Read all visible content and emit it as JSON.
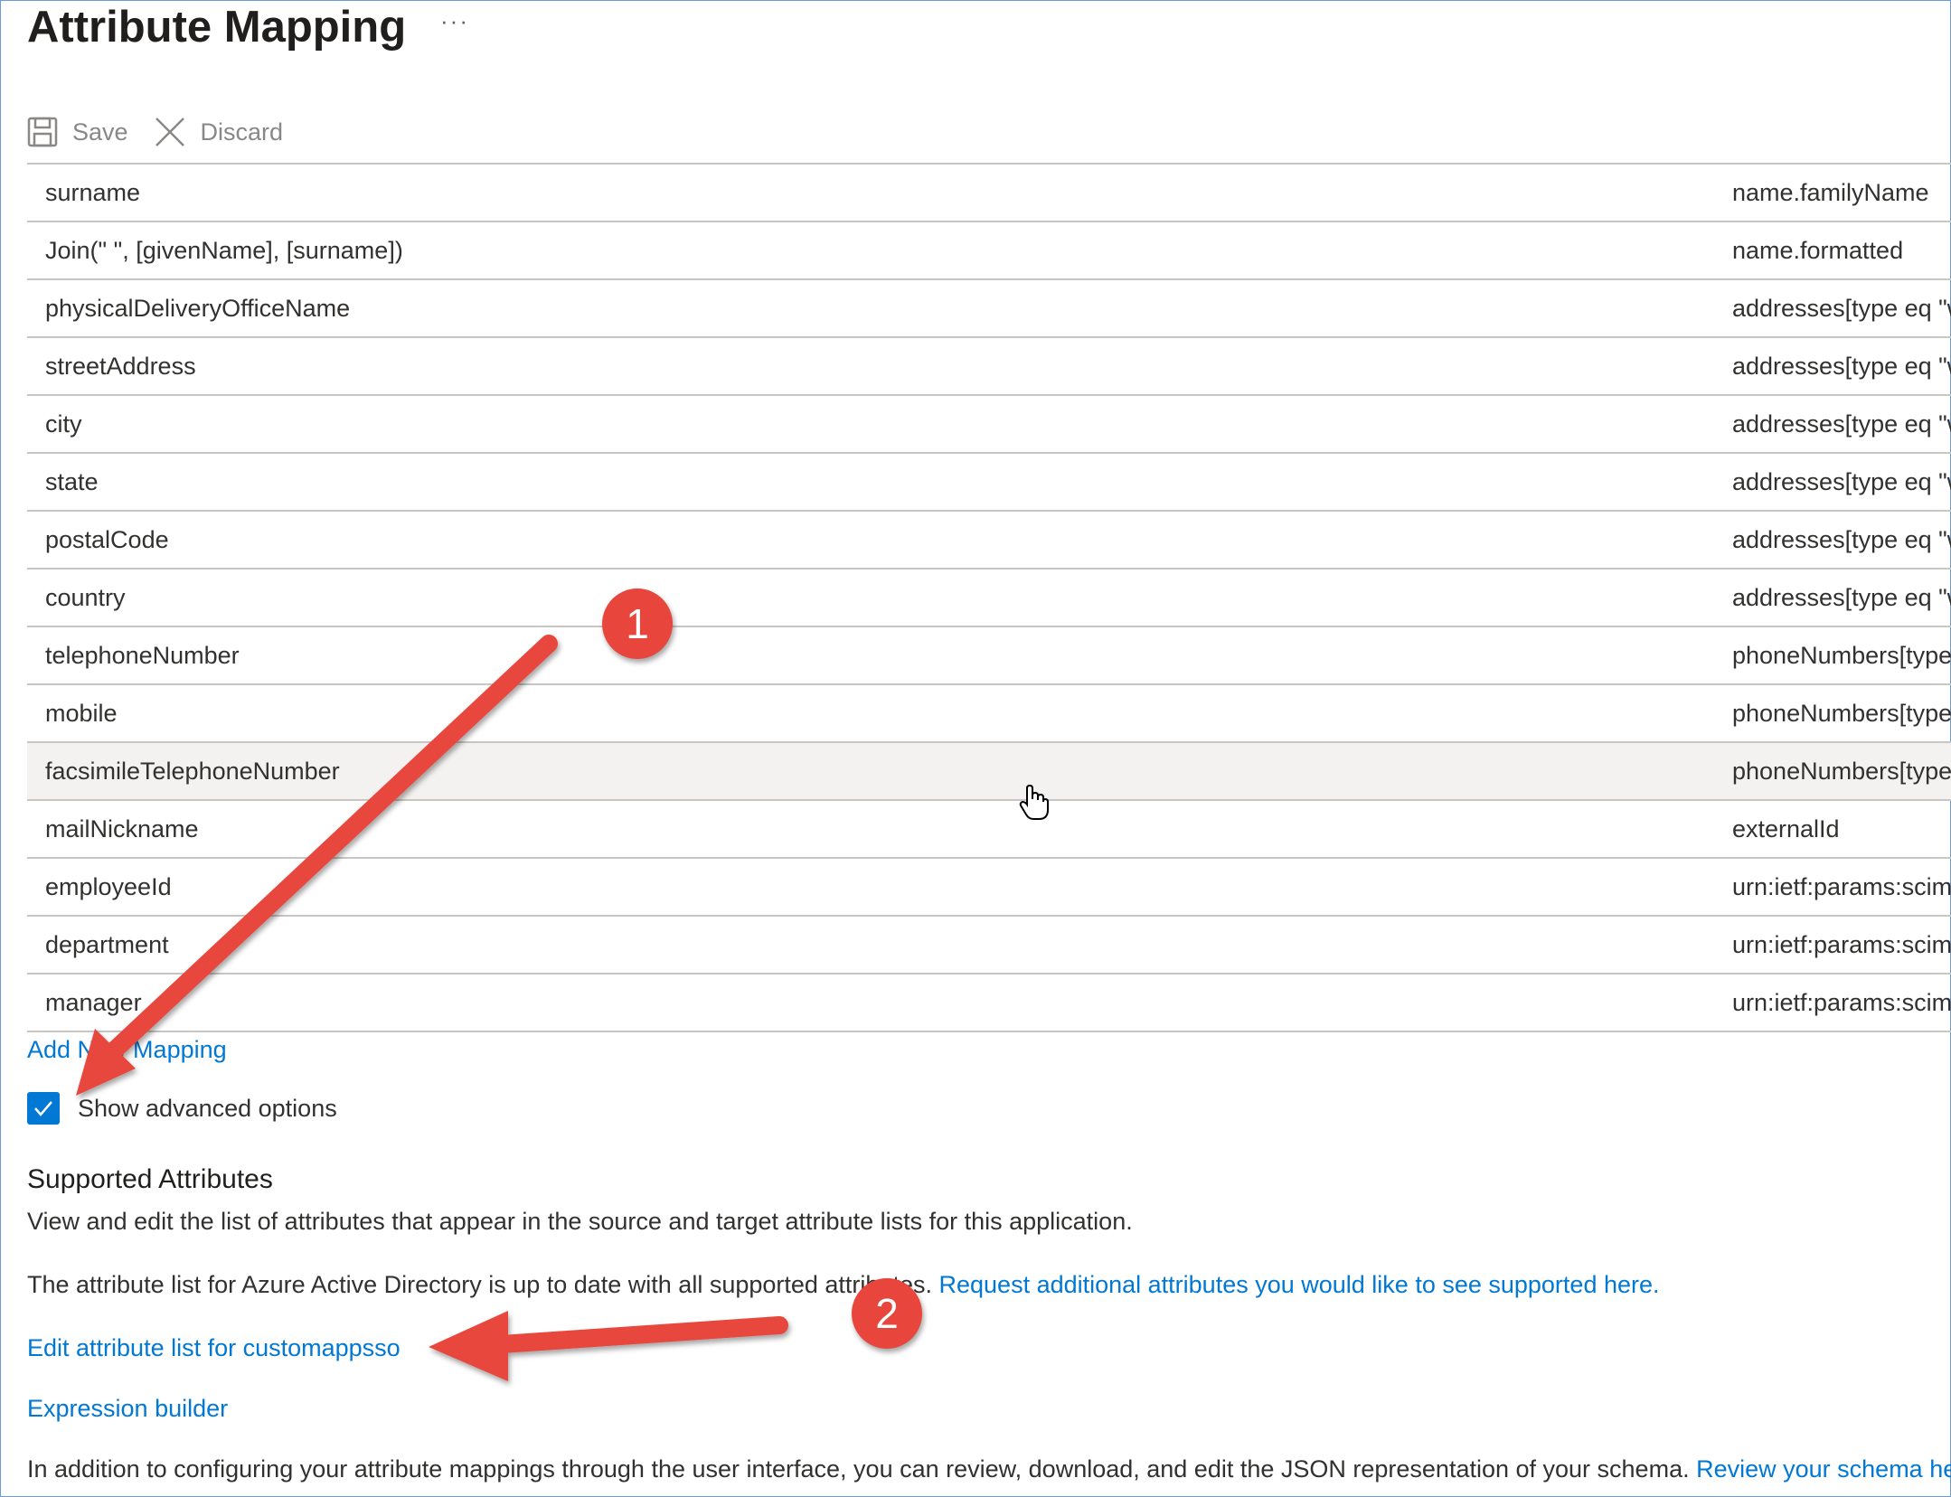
{
  "page": {
    "title": "Attribute Mapping",
    "more_label": "···"
  },
  "toolbar": {
    "save_label": "Save",
    "discard_label": "Discard"
  },
  "mappings": [
    {
      "source": "surname",
      "target": "name.familyName"
    },
    {
      "source": "Join(\" \", [givenName], [surname])",
      "target": "name.formatted"
    },
    {
      "source": "physicalDeliveryOfficeName",
      "target": "addresses[type eq \"w"
    },
    {
      "source": "streetAddress",
      "target": "addresses[type eq \"w"
    },
    {
      "source": "city",
      "target": "addresses[type eq \"w"
    },
    {
      "source": "state",
      "target": "addresses[type eq \"w"
    },
    {
      "source": "postalCode",
      "target": "addresses[type eq \"w"
    },
    {
      "source": "country",
      "target": "addresses[type eq \"w"
    },
    {
      "source": "telephoneNumber",
      "target": "phoneNumbers[type"
    },
    {
      "source": "mobile",
      "target": "phoneNumbers[type"
    },
    {
      "source": "facsimileTelephoneNumber",
      "target": "phoneNumbers[type"
    },
    {
      "source": "mailNickname",
      "target": "externalId"
    },
    {
      "source": "employeeId",
      "target": "urn:ietf:params:scim:s"
    },
    {
      "source": "department",
      "target": "urn:ietf:params:scim:s"
    },
    {
      "source": "manager",
      "target": "urn:ietf:params:scim:s"
    }
  ],
  "add_mapping_label": "Add New Mapping",
  "advanced": {
    "label": "Show advanced options",
    "checked": true
  },
  "supported": {
    "title": "Supported Attributes",
    "description": "View and edit the list of attributes that appear in the source and target attribute lists for this application.",
    "status_text": "The attribute list for Azure Active Directory is up to date with all supported attributes.",
    "request_link": "Request additional attributes you would like to see supported here.",
    "edit_link": "Edit attribute list for customappsso",
    "expression_link": "Expression builder",
    "json_text": "In addition to configuring your attribute mappings through the user interface, you can review, download, and edit the JSON representation of your schema.",
    "review_link": "Review your schema here."
  },
  "annotations": {
    "badge1": "1",
    "badge2": "2"
  },
  "colors": {
    "link": "#0078d4",
    "checkbox": "#0078d4",
    "annotation": "#e8463d",
    "row_hover": "#f3f2f1"
  }
}
